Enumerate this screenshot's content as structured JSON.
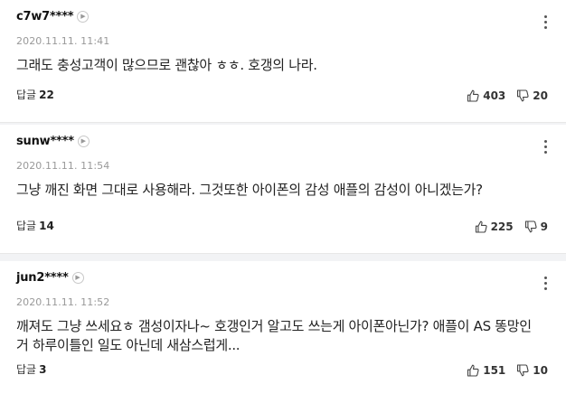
{
  "comments": [
    {
      "username": "c7w7****",
      "date": "2020.11.11.  11:41",
      "text": "그래도 충성고객이 많으므로 괜찮아 ㅎㅎ. 호갱의 나라.",
      "reply_label": "답글",
      "reply_count": "22",
      "likes": "403",
      "dislikes": "20"
    },
    {
      "username": "sunw****",
      "date": "2020.11.11.  11:54",
      "text": "그냥 깨진 화면 그대로 사용해라. 그것또한 아이폰의 감성 애플의 감성이 아니겠는가?",
      "reply_label": "답글",
      "reply_count": "14",
      "likes": "225",
      "dislikes": "9"
    },
    {
      "username": "jun2****",
      "date": "2020.11.11.  11:52",
      "text": "깨져도 그냥 쓰세요ㅎ 갬성이자나~ 호갱인거 알고도 쓰는게 아이폰아닌가? 애플이 AS 똥망인거 하루이틀인 일도 아닌데 새삼스럽게...",
      "reply_label": "답글",
      "reply_count": "3",
      "likes": "151",
      "dislikes": "10"
    }
  ],
  "icons": {
    "profile": "chevron-right-circle-icon",
    "more": "more-vertical-icon",
    "like": "thumbs-up-icon",
    "dislike": "thumbs-down-icon"
  }
}
